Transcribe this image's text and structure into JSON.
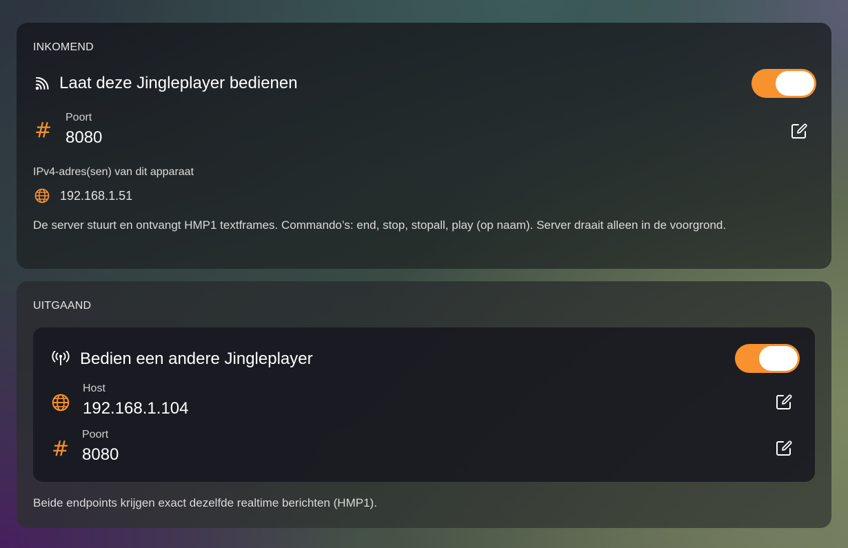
{
  "incoming": {
    "section_label": "INKOMEND",
    "toggle_title": "Laat deze Jingleplayer bedienen",
    "toggle_on": true,
    "port": {
      "label": "Poort",
      "value": "8080"
    },
    "ipv4_label": "IPv4-adres(sen) van dit apparaat",
    "ipv4_value": "192.168.1.51",
    "description": "De server stuurt en ontvangt HMP1 textframes. Commando’s: end, stop, stopall, play (op naam). Server draait alleen in de voorgrond."
  },
  "outgoing": {
    "section_label": "UITGAAND",
    "toggle_title": "Bedien een andere Jingleplayer",
    "toggle_on": true,
    "host": {
      "label": "Host",
      "value": "192.168.1.104"
    },
    "port": {
      "label": "Poort",
      "value": "8080"
    },
    "footer": "Beide endpoints krijgen exact dezelfde realtime berichten (HMP1)."
  },
  "icons": {
    "incoming_toggle": "rss-feed-icon",
    "port": "hash-icon",
    "globe": "globe-icon",
    "outgoing_toggle": "antenna-icon",
    "edit": "edit-icon"
  },
  "colors": {
    "accent": "#f7922e",
    "knob": "#ffffff",
    "text_primary": "#ffffff",
    "text_secondary": "#cfcfcf"
  }
}
